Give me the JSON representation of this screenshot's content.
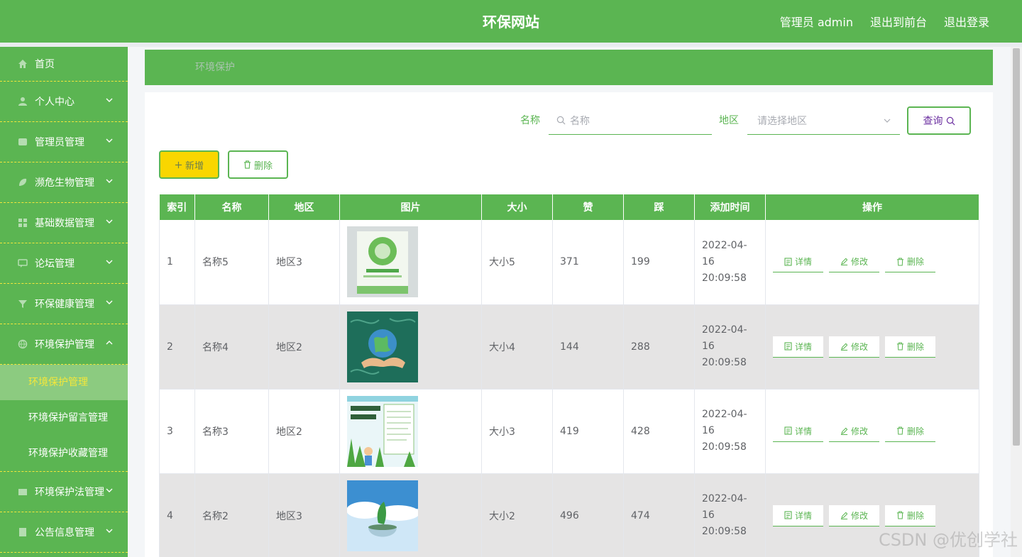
{
  "header": {
    "title": "环保网站",
    "user_label": "管理员 admin",
    "to_front": "退出到前台",
    "logout": "退出登录"
  },
  "sidebar": {
    "items": [
      {
        "label": "首页",
        "icon": "home-icon"
      },
      {
        "label": "个人中心",
        "icon": "user-icon"
      },
      {
        "label": "管理员管理",
        "icon": "admin-icon"
      },
      {
        "label": "濒危生物管理",
        "icon": "leaf-icon"
      },
      {
        "label": "基础数据管理",
        "icon": "grid-icon"
      },
      {
        "label": "论坛管理",
        "icon": "chat-icon"
      },
      {
        "label": "环保健康管理",
        "icon": "filter-icon"
      },
      {
        "label": "环境保护管理",
        "icon": "globe-icon"
      }
    ],
    "sub_items": [
      {
        "label": "环境保护管理",
        "active": true
      },
      {
        "label": "环境保护留言管理",
        "active": false
      },
      {
        "label": "环境保护收藏管理",
        "active": false
      }
    ],
    "items_after": [
      {
        "label": "环境保护法管理",
        "icon": "book-icon"
      },
      {
        "label": "公告信息管理",
        "icon": "notice-icon"
      }
    ]
  },
  "breadcrumb": "环境保护",
  "search": {
    "name_label": "名称",
    "name_placeholder": "名称",
    "region_label": "地区",
    "region_placeholder": "请选择地区",
    "query_label": "查询"
  },
  "actions": {
    "add": "新增",
    "delete": "删除"
  },
  "table": {
    "columns": [
      "索引",
      "名称",
      "地区",
      "图片",
      "大小",
      "赞",
      "踩",
      "添加时间",
      "操作"
    ],
    "rows": [
      {
        "index": "1",
        "name": "名称5",
        "region": "地区3",
        "size": "大小5",
        "likes": "371",
        "dislikes": "199",
        "date": "2022-04-16",
        "time": "20:09:58",
        "image": "poster-green-globe"
      },
      {
        "index": "2",
        "name": "名称4",
        "region": "地区2",
        "size": "大小4",
        "likes": "144",
        "dislikes": "288",
        "date": "2022-04-16",
        "time": "20:09:58",
        "image": "earth-hands"
      },
      {
        "index": "3",
        "name": "名称3",
        "region": "地区2",
        "size": "大小3",
        "likes": "419",
        "dislikes": "428",
        "date": "2022-04-16",
        "time": "20:09:58",
        "image": "garbage-sorting-poster"
      },
      {
        "index": "4",
        "name": "名称2",
        "region": "地区3",
        "size": "大小2",
        "likes": "496",
        "dislikes": "474",
        "date": "2022-04-16",
        "time": "20:09:58",
        "image": "sky-plant-bowl"
      }
    ],
    "op_detail": "详情",
    "op_edit": "修改",
    "op_delete": "删除"
  },
  "watermark": "CSDN @优创学社",
  "colors": {
    "primary": "#5bb552",
    "accent": "#f4e73a",
    "add_button": "#f9d600",
    "row_alt": "#e5e4e4"
  }
}
